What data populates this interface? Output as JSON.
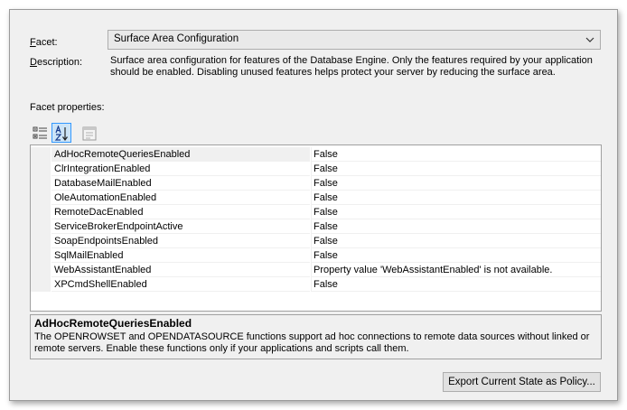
{
  "facet": {
    "label": "Facet:",
    "selected": "Surface Area Configuration"
  },
  "description": {
    "label": "Description:",
    "text": "Surface area configuration for features of the Database Engine. Only the features required by your application should be enabled. Disabling unused features helps protect your server by reducing the surface area."
  },
  "properties_label": "Facet properties:",
  "toolbar": {
    "icons": [
      "categorized-icon",
      "alphabetical-icon",
      "property-pages-icon"
    ],
    "active": "alphabetical-icon"
  },
  "properties": [
    {
      "name": "AdHocRemoteQueriesEnabled",
      "value": "False"
    },
    {
      "name": "ClrIntegrationEnabled",
      "value": "False"
    },
    {
      "name": "DatabaseMailEnabled",
      "value": "False"
    },
    {
      "name": "OleAutomationEnabled",
      "value": "False"
    },
    {
      "name": "RemoteDacEnabled",
      "value": "False"
    },
    {
      "name": "ServiceBrokerEndpointActive",
      "value": "False"
    },
    {
      "name": "SoapEndpointsEnabled",
      "value": "False"
    },
    {
      "name": "SqlMailEnabled",
      "value": "False"
    },
    {
      "name": "WebAssistantEnabled",
      "value": "Property value 'WebAssistantEnabled' is not available."
    },
    {
      "name": "XPCmdShellEnabled",
      "value": "False"
    }
  ],
  "help": {
    "title": "AdHocRemoteQueriesEnabled",
    "text": "The OPENROWSET and OPENDATASOURCE functions support ad hoc connections to remote data sources without linked or remote servers. Enable these functions only if your applications and scripts call them."
  },
  "export_button": "Export Current State as Policy...",
  "colors": {
    "selection": "#cce4f7",
    "selection_border": "#3399ff",
    "dialog_bg": "#f0f0f0"
  }
}
